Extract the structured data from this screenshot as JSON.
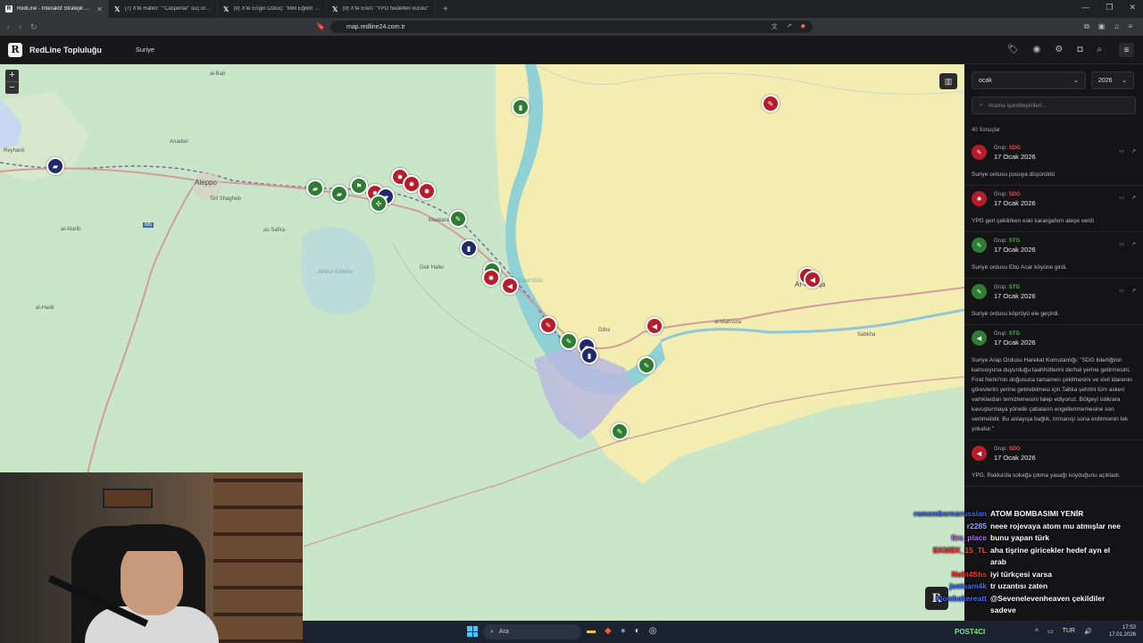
{
  "browser": {
    "tabs": [
      {
        "title": "RedLine - İnteraktif Stratejik Harit",
        "active": true
      },
      {
        "title": "(7) X'te Haber: \"\"Casperlar\" suç örgüt",
        "active": false
      },
      {
        "title": "(9) X'te Engin Özkoç: \"Milli Eğitim Ba",
        "active": false
      },
      {
        "title": "(9) X'te Eren: \"YPG hedefleri vurulu\"",
        "active": false
      }
    ],
    "new_tab": "+",
    "url": "map.redline24.com.tr"
  },
  "app": {
    "brand_logo": "R",
    "brand_name": "RedLine Topluluğu",
    "nav_link": "Suriye",
    "header_icons": [
      "tag-icon",
      "pin-icon",
      "settings-icon",
      "camera-icon",
      "search-icon"
    ],
    "menu_icon": "menu-icon"
  },
  "map": {
    "zoom_in": "+",
    "zoom_out": "−",
    "labels": {
      "aleppo": "Aleppo",
      "al_bab": "al-Bab",
      "as_safira": "as-Safira",
      "tell_shaghib": "Tell Shagheb",
      "al_hadir": "al-Hadir",
      "as_sabikhah": "Sabkha",
      "al_mansura": "al-Mansura",
      "maskana": "Maskana",
      "dibsi": "Dibsi",
      "raqqa": "Ar-Raqqa",
      "deir_hafer": "Deir Hafer",
      "reyhanli": "Reyhanlı",
      "al_atarib": "al-Atarib",
      "anadan": "Anadan",
      "m5": "M5",
      "lake_assad": "Esed Gölü",
      "jabbul": "Jabbul Sabkha"
    }
  },
  "sidebar": {
    "month": "ocak",
    "year": "2026",
    "search_placeholder": "Arama işaretleyicileri...",
    "result_count": "40 Sonuçlar",
    "items": [
      {
        "group_label": "Grup:",
        "group": "SDG",
        "date": "17 Ocak 2026",
        "text": "Suriye ordusu pusuya düşürüldü",
        "icon": "rifle-icon",
        "color": "red"
      },
      {
        "group_label": "Grup:",
        "group": "SDG",
        "date": "17 Ocak 2026",
        "text": "YPG geri çekilirken eski karargahını ateşe verdi",
        "icon": "fire-icon",
        "color": "red"
      },
      {
        "group_label": "Grup:",
        "group": "STG",
        "date": "17 Ocak 2026",
        "text": "Suriye ordusu Ebu Acar köyüne girdi.",
        "icon": "rifle-icon",
        "color": "green"
      },
      {
        "group_label": "Grup:",
        "group": "STG",
        "date": "17 Ocak 2026",
        "text": "Suriye ordusu köprüyü ele geçirdi.",
        "icon": "rifle-icon",
        "color": "green"
      },
      {
        "group_label": "Grup:",
        "group": "STG",
        "date": "17 Ocak 2026",
        "text": "Suriye Arap Ordusu Harekat Komutanlığı: \"SDG liderliğinin kamuoyuna duyurduğu taahhütlerini derhal yerine getirmesini, Fırat Nehri'nin doğusuna tamamen çekilmesini ve sivil idarenin görevlerini yerine getirebilmesi için Tabka şehrini tüm askeri varlıklardan temizlemesini talep ediyoruz. Bölgeyi istikrara kavuşturmaya yönelik çabaların engellenmemesine son verilmelidir. Bu anlayışa bağlık, tırmanışı sona erdirmenin tek yoludur.\"",
        "icon": "megaphone-icon",
        "color": "green"
      },
      {
        "group_label": "Grup:",
        "group": "SDG",
        "date": "17 Ocak 2026",
        "text": "YPG, Rakka'da sokağa çıkma yasağı koyduğunu açıkladı.",
        "icon": "megaphone-icon",
        "color": "red"
      }
    ]
  },
  "chat": [
    {
      "user": "remembernorussian",
      "text": "ATOM BOMBASIMI YENİR",
      "color": "#3d6fff"
    },
    {
      "user": "r2285",
      "text": "neee rojevaya atom mu atmışlar nee",
      "color": "#9aa0ff"
    },
    {
      "user": "fire_place",
      "text": "bunu yapan türk",
      "color": "#b36bff"
    },
    {
      "user": "EKMEK_15_TL",
      "text": "aha tişrine giricekler hedef ayn el arab",
      "color": "#ff4040"
    },
    {
      "user": "Nokt4Shs",
      "text": "iyi türkçesi varsa",
      "color": "#ff3030"
    },
    {
      "user": "justsam4k",
      "text": "tr uzantısı zaten",
      "color": "#3d6fff"
    },
    {
      "user": "Flowbakereatt",
      "text": "@Sevenelevenheaven çekildiler sadeve",
      "color": "#3d6fff"
    }
  ],
  "chat_logo": "R",
  "taskbar": {
    "search": "Ara",
    "label": "POST4CI",
    "lang": "TUR",
    "time": "17:53",
    "date": "17.01.2026"
  }
}
